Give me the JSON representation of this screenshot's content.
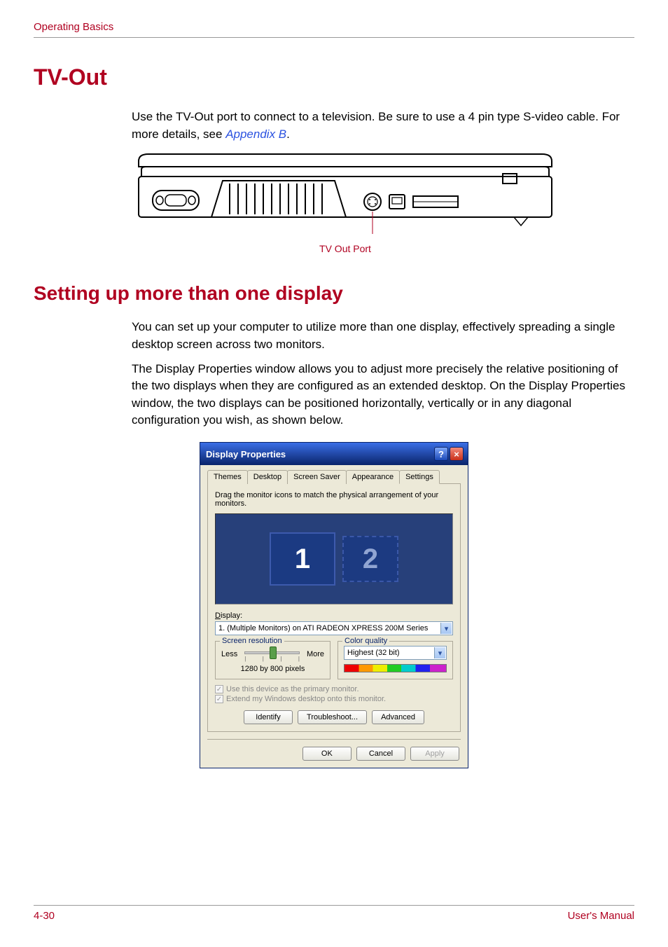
{
  "header": {
    "section": "Operating Basics"
  },
  "tvout": {
    "heading": "TV-Out",
    "para_pre": "Use the TV-Out port to connect to a television. Be sure to use a 4 pin type S-video cable. For more details, see ",
    "link": "Appendix B",
    "para_post": ".",
    "caption": "TV Out Port"
  },
  "setup": {
    "heading": "Setting up more than one display",
    "p1": "You can set up your computer to utilize more than one display, effectively spreading a single desktop screen across two monitors.",
    "p2": "The Display Properties window allows you to adjust more precisely the relative positioning of the two displays when they are configured as an extended desktop. On the Display Properties window, the two displays can be positioned horizontally, vertically or in any diagonal configuration you wish, as shown below."
  },
  "dialog": {
    "title": "Display Properties",
    "help": "?",
    "close": "×",
    "tabs": [
      "Themes",
      "Desktop",
      "Screen Saver",
      "Appearance",
      "Settings"
    ],
    "active_tab": "Settings",
    "instruction": "Drag the monitor icons to match the physical arrangement of your monitors.",
    "monitors": {
      "primary": "1",
      "secondary": "2"
    },
    "display_label_char": "D",
    "display_label_rest": "isplay:",
    "display_value": "1. (Multiple Monitors) on ATI RADEON XPRESS 200M Series",
    "res_legend_char": "S",
    "res_legend_rest": "creen resolution",
    "res_less": "Less",
    "res_more": "More",
    "res_value": "1280 by 800 pixels",
    "color_legend_char": "C",
    "color_legend_rest": "olor quality",
    "color_value": "Highest (32 bit)",
    "chk1_char": "U",
    "chk1_rest": "se this device as the primary monitor.",
    "chk2_char": "E",
    "chk2_rest": "xtend my Windows desktop onto this monitor.",
    "btn_identify_char": "I",
    "btn_identify_rest": "dentify",
    "btn_trouble_char": "T",
    "btn_trouble_rest": "roubleshoot...",
    "btn_adv_pre": "Ad",
    "btn_adv_char": "v",
    "btn_adv_post": "anced",
    "btn_ok": "OK",
    "btn_cancel": "Cancel",
    "btn_apply_char": "A",
    "btn_apply_rest": "pply"
  },
  "footer": {
    "page": "4-30",
    "label": "User's Manual"
  }
}
